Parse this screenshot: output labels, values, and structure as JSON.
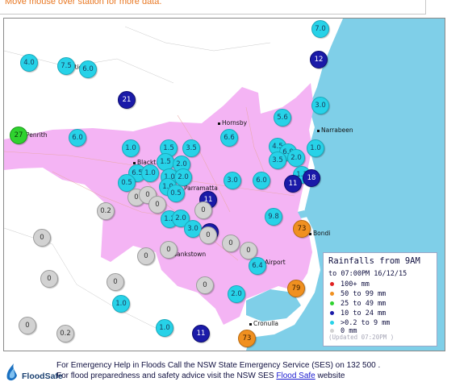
{
  "header": {
    "hint": "Move mouse over station for more data."
  },
  "places": [
    {
      "id": "penrith",
      "label": "Penrith"
    },
    {
      "id": "richmond",
      "label": "Ric...d"
    },
    {
      "id": "hornsby",
      "label": "Hornsby"
    },
    {
      "id": "narrabeen",
      "label": "Narrabeen"
    },
    {
      "id": "blacktown",
      "label": "Blackt..."
    },
    {
      "id": "parramatta",
      "label": "Parramatta"
    },
    {
      "id": "bondi",
      "label": "Bondi"
    },
    {
      "id": "bankstown",
      "label": "Bankstown"
    },
    {
      "id": "airport",
      "label": "Airport"
    },
    {
      "id": "cronulla",
      "label": "Cronulla"
    }
  ],
  "stations": [
    {
      "v": "7.0",
      "c": "cyan"
    },
    {
      "v": "4.0",
      "c": "cyan"
    },
    {
      "v": "7.5",
      "c": "cyan"
    },
    {
      "v": "6.0",
      "c": "cyan"
    },
    {
      "v": "12",
      "c": "blue"
    },
    {
      "v": "21",
      "c": "blue"
    },
    {
      "v": "3.0",
      "c": "cyan"
    },
    {
      "v": "5.6",
      "c": "cyan"
    },
    {
      "v": "27",
      "c": "green"
    },
    {
      "v": "6.0",
      "c": "cyan"
    },
    {
      "v": "6.6",
      "c": "cyan"
    },
    {
      "v": "1.0",
      "c": "cyan"
    },
    {
      "v": "1.5",
      "c": "cyan"
    },
    {
      "v": "3.5",
      "c": "cyan"
    },
    {
      "v": "4.5",
      "c": "cyan"
    },
    {
      "v": "6.0",
      "c": "cyan"
    },
    {
      "v": "2.0",
      "c": "cyan"
    },
    {
      "v": "1.0",
      "c": "cyan"
    },
    {
      "v": "3.5",
      "c": "cyan"
    },
    {
      "v": "1.5",
      "c": "cyan"
    },
    {
      "v": "2.0",
      "c": "cyan"
    },
    {
      "v": "6.5",
      "c": "cyan"
    },
    {
      "v": "1.0",
      "c": "cyan"
    },
    {
      "v": "1.0",
      "c": "cyan"
    },
    {
      "v": "2.0",
      "c": "cyan"
    },
    {
      "v": "0.5",
      "c": "cyan"
    },
    {
      "v": "1.0",
      "c": "cyan"
    },
    {
      "v": "3.0",
      "c": "cyan"
    },
    {
      "v": "6.0",
      "c": "cyan"
    },
    {
      "v": "1.1",
      "c": "cyan"
    },
    {
      "v": "18",
      "c": "blue"
    },
    {
      "v": "11",
      "c": "blue"
    },
    {
      "v": "0.5",
      "c": "cyan"
    },
    {
      "v": "0",
      "c": "grey"
    },
    {
      "v": "0",
      "c": "grey"
    },
    {
      "v": "11",
      "c": "blue"
    },
    {
      "v": "0",
      "c": "grey"
    },
    {
      "v": "0.2",
      "c": "grey"
    },
    {
      "v": "0",
      "c": "grey"
    },
    {
      "v": "1.2",
      "c": "cyan"
    },
    {
      "v": "2.0",
      "c": "cyan"
    },
    {
      "v": "9.8",
      "c": "cyan"
    },
    {
      "v": "73",
      "c": "orange"
    },
    {
      "v": "3.0",
      "c": "cyan"
    },
    {
      "v": "10",
      "c": "blue"
    },
    {
      "v": "0",
      "c": "grey"
    },
    {
      "v": "0",
      "c": "grey"
    },
    {
      "v": "0",
      "c": "grey"
    },
    {
      "v": "0",
      "c": "grey"
    },
    {
      "v": "0",
      "c": "grey"
    },
    {
      "v": "0",
      "c": "grey"
    },
    {
      "v": "6.4",
      "c": "cyan"
    },
    {
      "v": "0",
      "c": "grey"
    },
    {
      "v": "0",
      "c": "grey"
    },
    {
      "v": "0",
      "c": "grey"
    },
    {
      "v": "79",
      "c": "orange"
    },
    {
      "v": "2.0",
      "c": "cyan"
    },
    {
      "v": "1.0",
      "c": "cyan"
    },
    {
      "v": "0",
      "c": "grey"
    },
    {
      "v": "1.0",
      "c": "cyan"
    },
    {
      "v": "0.2",
      "c": "grey"
    },
    {
      "v": "11",
      "c": "blue"
    },
    {
      "v": "73",
      "c": "orange"
    }
  ],
  "legend": {
    "title": "Rainfalls from 9AM",
    "subtitle": "to 07:00PM 16/12/15",
    "items": [
      {
        "label": "100+ mm",
        "color": "#e02020"
      },
      {
        "label": "50  to 99 mm",
        "color": "#f09020"
      },
      {
        "label": "25  to 49 mm",
        "color": "#2fd22f"
      },
      {
        "label": "10  to 24 mm",
        "color": "#1a1aa8"
      },
      {
        "label": ">0.2 to 9 mm",
        "color": "#27d2e8"
      },
      {
        "label": "0 mm",
        "color": "#d2d2d2"
      }
    ],
    "updated": "(Updated 07:20PM )"
  },
  "footer": {
    "logo_text": "FloodSafe",
    "line1": "For Emergency Help in Floods Call the NSW State Emergency Service (SES) on 132 500 .",
    "line2_prefix": "For flood preparedness and safety advice visit the NSW SES ",
    "line2_link": "Flood Safe",
    "line2_suffix": " website"
  },
  "colors": {
    "urban": "#f4b4f4",
    "ocean": "#7fcfe8",
    "accent": "#e87722"
  }
}
